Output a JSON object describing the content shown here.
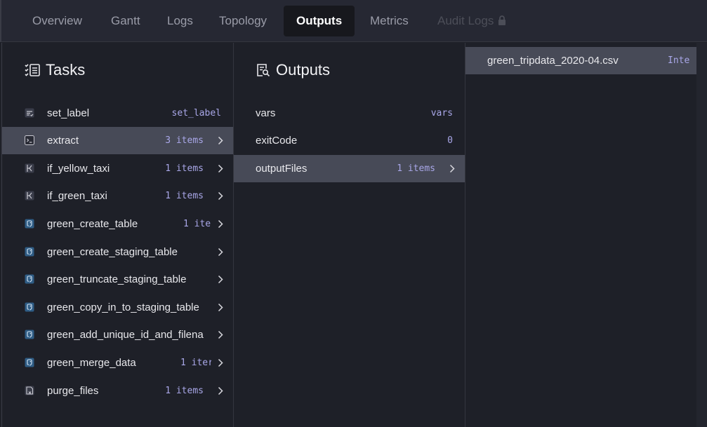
{
  "tabs": [
    {
      "label": "Overview"
    },
    {
      "label": "Gantt"
    },
    {
      "label": "Logs"
    },
    {
      "label": "Topology"
    },
    {
      "label": "Outputs"
    },
    {
      "label": "Metrics"
    },
    {
      "label": "Audit Logs"
    }
  ],
  "tasks_panel": {
    "title": "Tasks",
    "rows": [
      {
        "label": "set_label",
        "value": "set_label",
        "icon": "set-label-icon"
      },
      {
        "label": "extract",
        "value": "3 items",
        "icon": "terminal-icon"
      },
      {
        "label": "if_yellow_taxi",
        "value": "1 items",
        "icon": "branch-icon"
      },
      {
        "label": "if_green_taxi",
        "value": "1 items",
        "icon": "branch-icon"
      },
      {
        "label": "green_create_table",
        "value": "1 ite",
        "icon": "postgres-icon"
      },
      {
        "label": "green_create_staging_table",
        "value": "",
        "icon": "postgres-icon"
      },
      {
        "label": "green_truncate_staging_table",
        "value": "",
        "icon": "postgres-icon"
      },
      {
        "label": "green_copy_in_to_staging_table",
        "value": "",
        "icon": "postgres-icon"
      },
      {
        "label": "green_add_unique_id_and_filena",
        "value": "",
        "icon": "postgres-icon"
      },
      {
        "label": "green_merge_data",
        "value": "1 iter",
        "icon": "postgres-icon"
      },
      {
        "label": "purge_files",
        "value": "1 items",
        "icon": "purge-icon"
      }
    ]
  },
  "outputs_panel": {
    "title": "Outputs",
    "rows": [
      {
        "label": "vars",
        "value": "vars"
      },
      {
        "label": "exitCode",
        "value": "0"
      },
      {
        "label": "outputFiles",
        "value": "1 items"
      }
    ]
  },
  "files_panel": {
    "rows": [
      {
        "label": "green_tripdata_2020-04.csv",
        "value": "Inte"
      }
    ]
  }
}
